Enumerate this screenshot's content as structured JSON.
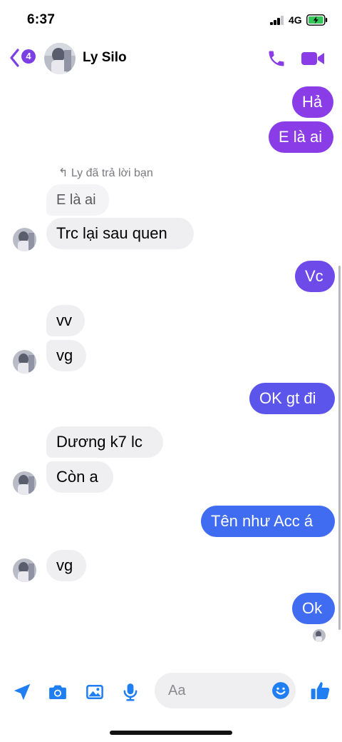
{
  "status_bar": {
    "time": "6:37",
    "network": "4G"
  },
  "header": {
    "back_badge": "4",
    "contact_name": "Ly Silo"
  },
  "reply_note": "Ly đã trả lời bạn",
  "messages": [
    {
      "text": "Hả",
      "from": "me"
    },
    {
      "text": "E là ai",
      "from": "me"
    },
    {
      "text": "E là ai",
      "from": "them",
      "quoted": true
    },
    {
      "text": "Trc lại sau quen",
      "from": "them"
    },
    {
      "text": "Vc",
      "from": "me"
    },
    {
      "text": "vv",
      "from": "them"
    },
    {
      "text": "vg",
      "from": "them"
    },
    {
      "text": "OK gt đi",
      "from": "me"
    },
    {
      "text": "Dương k7 lc",
      "from": "them"
    },
    {
      "text": "Còn a",
      "from": "them"
    },
    {
      "text": "Tên như Acc á",
      "from": "me"
    },
    {
      "text": "vg",
      "from": "them"
    },
    {
      "text": "Ok",
      "from": "me"
    }
  ],
  "composer": {
    "placeholder": "Aa",
    "icons": [
      "location-arrow-icon",
      "camera-icon",
      "image-icon",
      "microphone-icon",
      "emoji-icon",
      "thumbs-up-icon"
    ]
  },
  "colors": {
    "accent": "#7b3fe4",
    "bubble_purple": "#8a3ce6",
    "bubble_violet": "#6e4ae8",
    "bubble_indigo": "#5b55ec",
    "bubble_blue": "#3f6cf0",
    "bubble_incoming": "#efeff1",
    "composer_blue": "#1f7ef2"
  }
}
